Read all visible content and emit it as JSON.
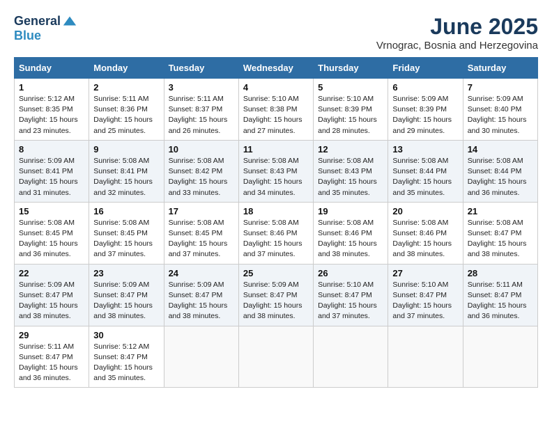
{
  "header": {
    "logo_line1": "General",
    "logo_line2": "Blue",
    "month_title": "June 2025",
    "subtitle": "Vrnograc, Bosnia and Herzegovina"
  },
  "weekdays": [
    "Sunday",
    "Monday",
    "Tuesday",
    "Wednesday",
    "Thursday",
    "Friday",
    "Saturday"
  ],
  "weeks": [
    [
      {
        "day": 1,
        "sunrise": "5:12 AM",
        "sunset": "8:35 PM",
        "daylight": "15 hours and 23 minutes."
      },
      {
        "day": 2,
        "sunrise": "5:11 AM",
        "sunset": "8:36 PM",
        "daylight": "15 hours and 25 minutes."
      },
      {
        "day": 3,
        "sunrise": "5:11 AM",
        "sunset": "8:37 PM",
        "daylight": "15 hours and 26 minutes."
      },
      {
        "day": 4,
        "sunrise": "5:10 AM",
        "sunset": "8:38 PM",
        "daylight": "15 hours and 27 minutes."
      },
      {
        "day": 5,
        "sunrise": "5:10 AM",
        "sunset": "8:39 PM",
        "daylight": "15 hours and 28 minutes."
      },
      {
        "day": 6,
        "sunrise": "5:09 AM",
        "sunset": "8:39 PM",
        "daylight": "15 hours and 29 minutes."
      },
      {
        "day": 7,
        "sunrise": "5:09 AM",
        "sunset": "8:40 PM",
        "daylight": "15 hours and 30 minutes."
      }
    ],
    [
      {
        "day": 8,
        "sunrise": "5:09 AM",
        "sunset": "8:41 PM",
        "daylight": "15 hours and 31 minutes."
      },
      {
        "day": 9,
        "sunrise": "5:08 AM",
        "sunset": "8:41 PM",
        "daylight": "15 hours and 32 minutes."
      },
      {
        "day": 10,
        "sunrise": "5:08 AM",
        "sunset": "8:42 PM",
        "daylight": "15 hours and 33 minutes."
      },
      {
        "day": 11,
        "sunrise": "5:08 AM",
        "sunset": "8:43 PM",
        "daylight": "15 hours and 34 minutes."
      },
      {
        "day": 12,
        "sunrise": "5:08 AM",
        "sunset": "8:43 PM",
        "daylight": "15 hours and 35 minutes."
      },
      {
        "day": 13,
        "sunrise": "5:08 AM",
        "sunset": "8:44 PM",
        "daylight": "15 hours and 35 minutes."
      },
      {
        "day": 14,
        "sunrise": "5:08 AM",
        "sunset": "8:44 PM",
        "daylight": "15 hours and 36 minutes."
      }
    ],
    [
      {
        "day": 15,
        "sunrise": "5:08 AM",
        "sunset": "8:45 PM",
        "daylight": "15 hours and 36 minutes."
      },
      {
        "day": 16,
        "sunrise": "5:08 AM",
        "sunset": "8:45 PM",
        "daylight": "15 hours and 37 minutes."
      },
      {
        "day": 17,
        "sunrise": "5:08 AM",
        "sunset": "8:45 PM",
        "daylight": "15 hours and 37 minutes."
      },
      {
        "day": 18,
        "sunrise": "5:08 AM",
        "sunset": "8:46 PM",
        "daylight": "15 hours and 37 minutes."
      },
      {
        "day": 19,
        "sunrise": "5:08 AM",
        "sunset": "8:46 PM",
        "daylight": "15 hours and 38 minutes."
      },
      {
        "day": 20,
        "sunrise": "5:08 AM",
        "sunset": "8:46 PM",
        "daylight": "15 hours and 38 minutes."
      },
      {
        "day": 21,
        "sunrise": "5:08 AM",
        "sunset": "8:47 PM",
        "daylight": "15 hours and 38 minutes."
      }
    ],
    [
      {
        "day": 22,
        "sunrise": "5:09 AM",
        "sunset": "8:47 PM",
        "daylight": "15 hours and 38 minutes."
      },
      {
        "day": 23,
        "sunrise": "5:09 AM",
        "sunset": "8:47 PM",
        "daylight": "15 hours and 38 minutes."
      },
      {
        "day": 24,
        "sunrise": "5:09 AM",
        "sunset": "8:47 PM",
        "daylight": "15 hours and 38 minutes."
      },
      {
        "day": 25,
        "sunrise": "5:09 AM",
        "sunset": "8:47 PM",
        "daylight": "15 hours and 38 minutes."
      },
      {
        "day": 26,
        "sunrise": "5:10 AM",
        "sunset": "8:47 PM",
        "daylight": "15 hours and 37 minutes."
      },
      {
        "day": 27,
        "sunrise": "5:10 AM",
        "sunset": "8:47 PM",
        "daylight": "15 hours and 37 minutes."
      },
      {
        "day": 28,
        "sunrise": "5:11 AM",
        "sunset": "8:47 PM",
        "daylight": "15 hours and 36 minutes."
      }
    ],
    [
      {
        "day": 29,
        "sunrise": "5:11 AM",
        "sunset": "8:47 PM",
        "daylight": "15 hours and 36 minutes."
      },
      {
        "day": 30,
        "sunrise": "5:12 AM",
        "sunset": "8:47 PM",
        "daylight": "15 hours and 35 minutes."
      },
      null,
      null,
      null,
      null,
      null
    ]
  ]
}
